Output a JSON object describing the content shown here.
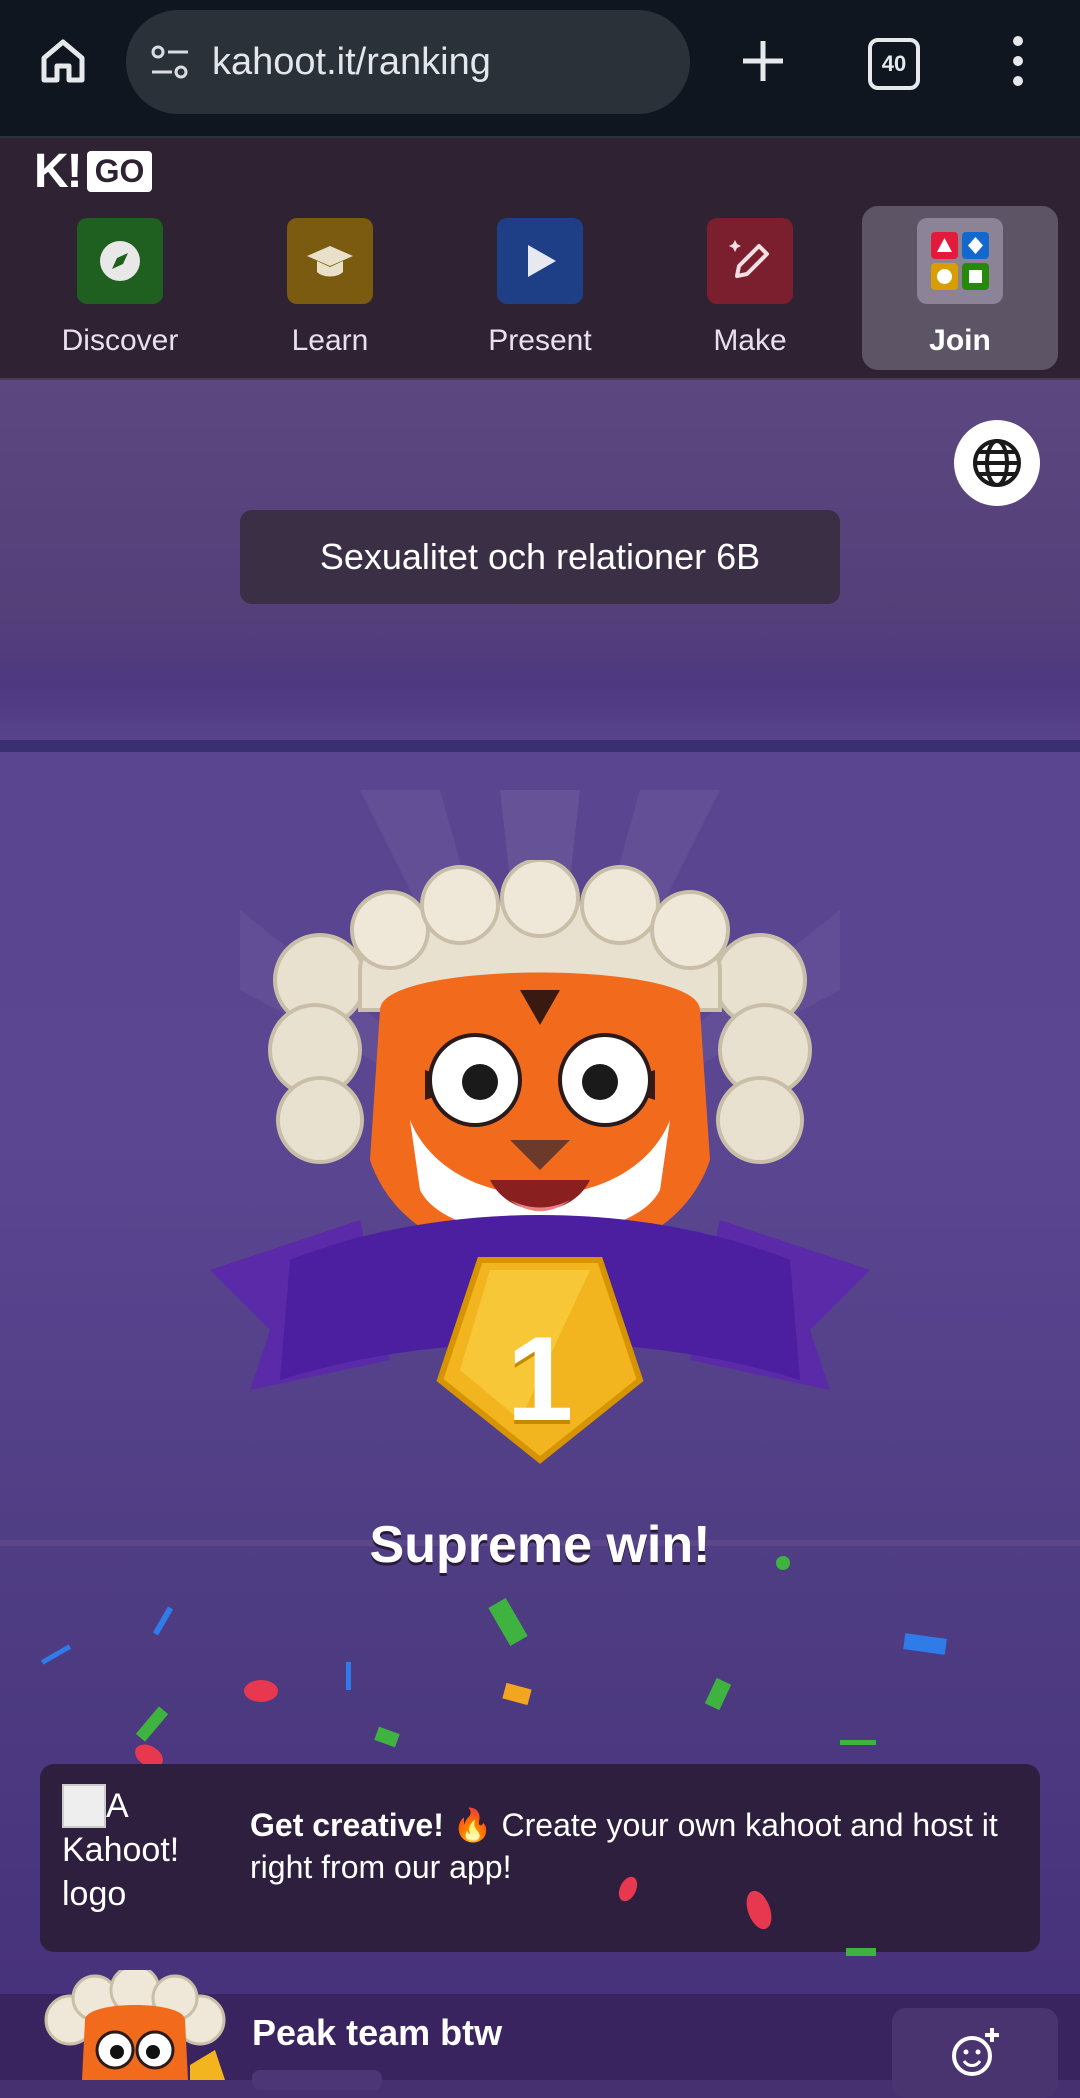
{
  "browser": {
    "url": "kahoot.it/ranking",
    "tab_count": "40"
  },
  "app": {
    "logo_k": "K!",
    "logo_go": "GO",
    "nav": [
      {
        "label": "Discover",
        "color": "#1f5f1f"
      },
      {
        "label": "Learn",
        "color": "#7a5b10"
      },
      {
        "label": "Present",
        "color": "#1e3f86"
      },
      {
        "label": "Make",
        "color": "#7b1e2e"
      },
      {
        "label": "Join",
        "active": true
      }
    ]
  },
  "game": {
    "quiz_title": "Sexualitet och relationer 6B",
    "rank": "1",
    "result_text": "Supreme win!"
  },
  "banner": {
    "image_alt": "A Kahoot! logo",
    "bold": "Get creative!",
    "emoji": "🔥",
    "message": "Create your own kahoot and host it right from our app!"
  },
  "player": {
    "name": "Peak team btw"
  },
  "colors": {
    "accent_purple": "#5b4691",
    "medal_gold": "#f2b41f"
  }
}
